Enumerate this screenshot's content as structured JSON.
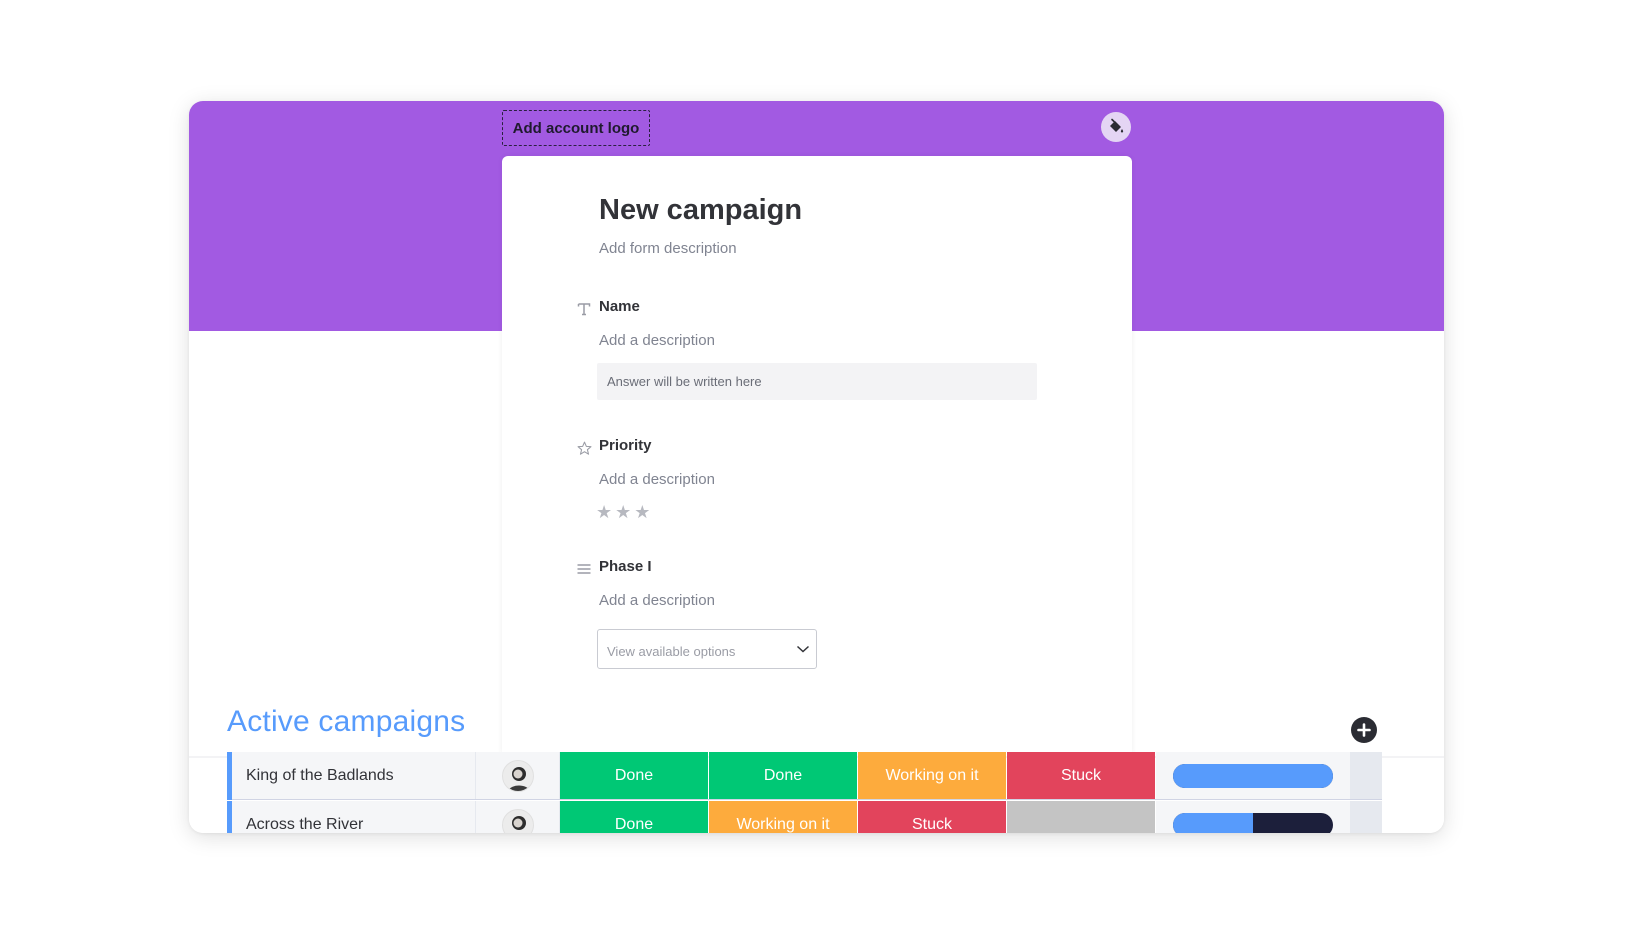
{
  "form": {
    "logo_button": "Add account logo",
    "title": "New campaign",
    "description_placeholder": "Add form description",
    "questions": [
      {
        "label": "Name",
        "icon": "text-type-icon",
        "description": "Add a description",
        "input_placeholder": "Answer will be written here"
      },
      {
        "label": "Priority",
        "icon": "star-outline-icon",
        "description": "Add a description",
        "rating_max": 3,
        "rating_value": 0
      },
      {
        "label": "Phase I",
        "icon": "list-lines-icon",
        "description": "Add a description",
        "select_placeholder": "View available options"
      }
    ]
  },
  "board": {
    "group_title": "Active campaigns",
    "rows": [
      {
        "name": "King of the Badlands",
        "statuses": [
          {
            "label": "Done",
            "color": "#00c875"
          },
          {
            "label": "Done",
            "color": "#00c875"
          },
          {
            "label": "Working on it",
            "color": "#fdab3d"
          },
          {
            "label": "Stuck",
            "color": "#e2445c"
          }
        ],
        "timeline_progress": 1.0
      },
      {
        "name": "Across the River",
        "statuses": [
          {
            "label": "Done",
            "color": "#00c875"
          },
          {
            "label": "Working on it",
            "color": "#fdab3d"
          },
          {
            "label": "Stuck",
            "color": "#e2445c"
          },
          {
            "label": "",
            "color": "#c4c4c4"
          }
        ],
        "timeline_progress": 0.5
      }
    ]
  },
  "colors": {
    "banner": "#a25ae2",
    "group_accent": "#579bfc",
    "done": "#00c875",
    "working": "#fdab3d",
    "stuck": "#e2445c",
    "empty": "#c4c4c4"
  }
}
